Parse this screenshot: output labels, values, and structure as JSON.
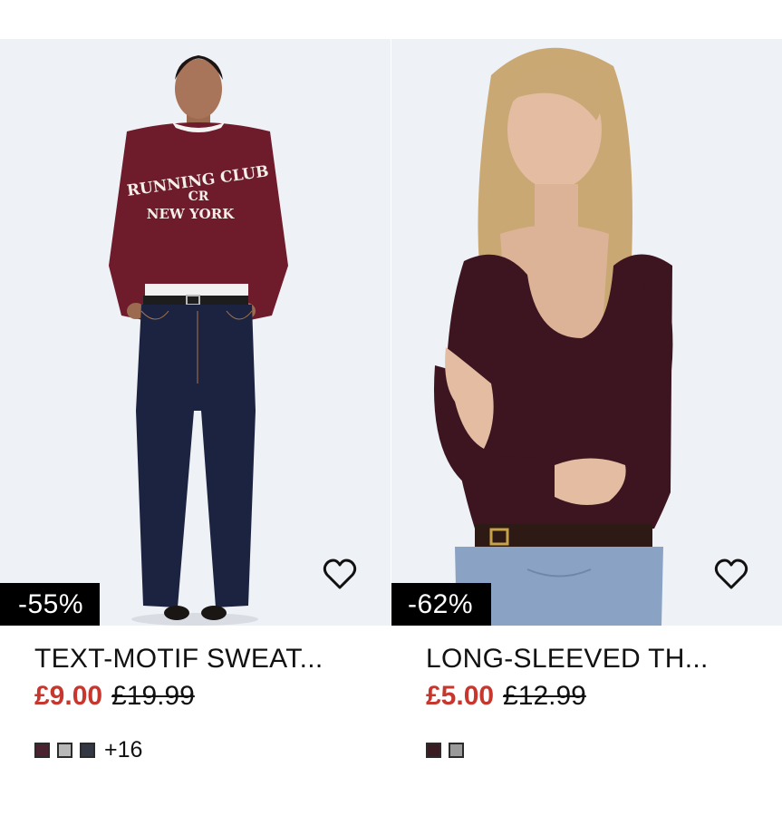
{
  "products": [
    {
      "title": "TEXT-MOTIF SWEAT...",
      "discount": "-55%",
      "price_now": "£9.00",
      "price_old": "£19.99",
      "swatches": [
        "#4a2230",
        "#b8b8b8",
        "#343844"
      ],
      "more_colors": "+16",
      "sweatshirt_print": {
        "line1": "RUNNING CLUB",
        "line2": "NEW YORK",
        "monogram": "CR"
      }
    },
    {
      "title": "LONG-SLEEVED TH...",
      "discount": "-62%",
      "price_now": "£5.00",
      "price_old": "£12.99",
      "swatches": [
        "#3a1c22",
        "#9a9a9a"
      ],
      "more_colors": ""
    }
  ],
  "colors": {
    "sale_price": "#c8372d",
    "badge_bg": "#000000",
    "badge_text": "#ffffff",
    "burgundy": "#6e1b2c",
    "plum": "#3c1520",
    "denim_dark": "#1c2340",
    "denim_light": "#8aa2c4"
  },
  "icons": [
    "heart-outline-icon"
  ]
}
